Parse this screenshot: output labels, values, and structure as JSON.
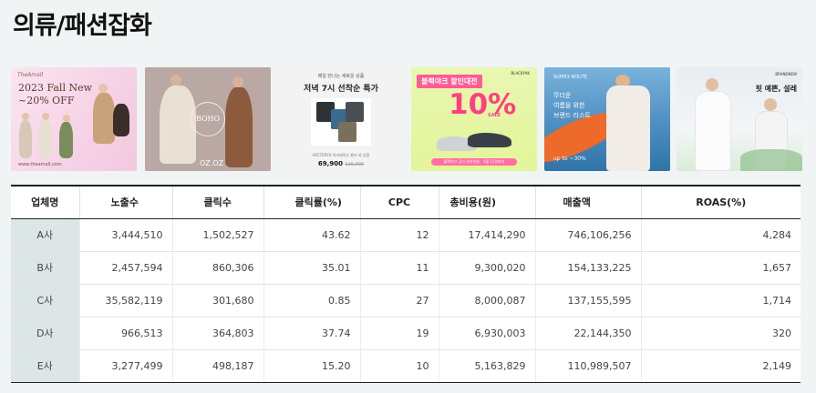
{
  "page": {
    "title": "의류/패션잡화"
  },
  "banners": [
    {
      "brand": "TheAmall",
      "line1": "2023 Fall New",
      "line2": "~20% OFF",
      "url": "www.theamall.com"
    },
    {
      "badge": "BOHO",
      "brand": "OZ.OZ"
    },
    {
      "subtitle": "매일 만나는 새로운 상품",
      "headline": "저녁 7시 선착순 특가",
      "caption": "ARCTERYX 아크테릭스 팬츠 외 상품",
      "price": "69,900",
      "original_price": "115,000"
    },
    {
      "tag": "블랙야크 할인대전",
      "brand": "BLACKYAK",
      "percent": "10%",
      "sale": "SALE",
      "footer": "블랙야크 공식 온라인몰 · 5월 11일까지"
    },
    {
      "brand": "SUPPLY ROUTE",
      "line1": "무더운",
      "line2": "여름을 위한",
      "line3": "브랜드 리스트",
      "discount": "up to ~30%"
    },
    {
      "brand": "BRANDNEW",
      "caption": "핏 예쁜, 설레"
    }
  ],
  "table": {
    "headers": [
      "업체명",
      "노출수",
      "클릭수",
      "클릭률(%)",
      "CPC",
      "총비용(원)",
      "매출액",
      "ROAS(%)"
    ],
    "rows": [
      {
        "name": "A사",
        "impressions": "3,444,510",
        "clicks": "1,502,527",
        "ctr": "43.62",
        "cpc": "12",
        "cost": "17,414,290",
        "revenue": "746,106,256",
        "roas": "4,284"
      },
      {
        "name": "B사",
        "impressions": "2,457,594",
        "clicks": "860,306",
        "ctr": "35.01",
        "cpc": "11",
        "cost": "9,300,020",
        "revenue": "154,133,225",
        "roas": "1,657"
      },
      {
        "name": "C사",
        "impressions": "35,582,119",
        "clicks": "301,680",
        "ctr": "0.85",
        "cpc": "27",
        "cost": "8,000,087",
        "revenue": "137,155,595",
        "roas": "1,714"
      },
      {
        "name": "D사",
        "impressions": "966,513",
        "clicks": "364,803",
        "ctr": "37.74",
        "cpc": "19",
        "cost": "6,930,003",
        "revenue": "22,144,350",
        "roas": "320"
      },
      {
        "name": "E사",
        "impressions": "3,277,499",
        "clicks": "498,187",
        "ctr": "15.20",
        "cpc": "10",
        "cost": "5,163,829",
        "revenue": "110,989,507",
        "roas": "2,149"
      }
    ]
  }
}
